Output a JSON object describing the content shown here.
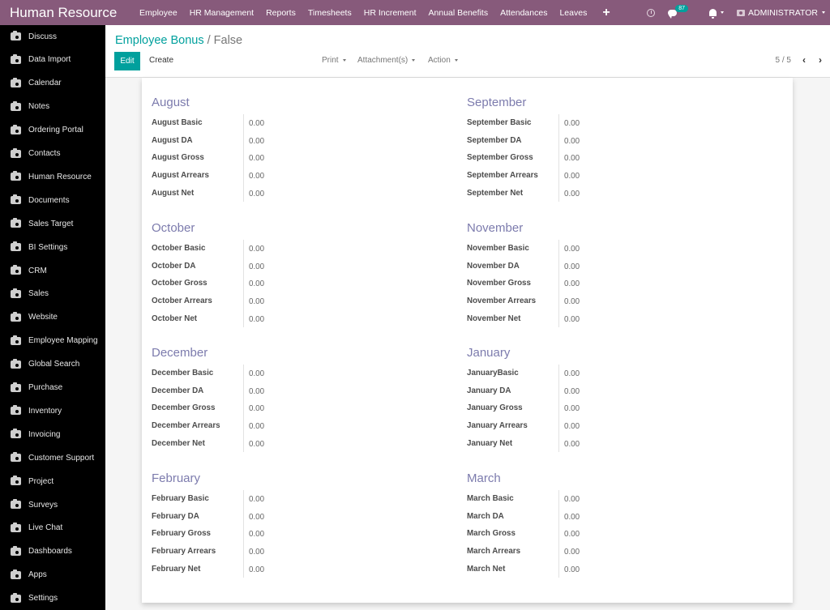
{
  "app_title": "Human Resource",
  "top_menu": [
    "Employee",
    "HR Management",
    "Reports",
    "Timesheets",
    "HR Increment",
    "Annual Benefits",
    "Attendances",
    "Leaves"
  ],
  "systray": {
    "chat_badge": "87",
    "user_name": "ADMINISTRATOR"
  },
  "sidebar": {
    "items": [
      "Discuss",
      "Data Import",
      "Calendar",
      "Notes",
      "Ordering Portal",
      "Contacts",
      "Human Resource",
      "Documents",
      "Sales Target",
      "BI Settings",
      "CRM",
      "Sales",
      "Website",
      "Employee Mapping",
      "Global Search",
      "Purchase",
      "Inventory",
      "Invoicing",
      "Customer Support",
      "Project",
      "Surveys",
      "Live Chat",
      "Dashboards",
      "Apps",
      "Settings"
    ]
  },
  "control_panel": {
    "breadcrumb_parent": "Employee Bonus",
    "breadcrumb_separator": "/",
    "breadcrumb_current": "False",
    "edit_label": "Edit",
    "create_label": "Create",
    "print_label": "Print",
    "attachments_label": "Attachment(s)",
    "action_label": "Action",
    "pager": "5 / 5"
  },
  "groups": [
    {
      "title": "August",
      "fields": [
        {
          "label": "August Basic",
          "value": "0.00"
        },
        {
          "label": "August DA",
          "value": "0.00"
        },
        {
          "label": "August Gross",
          "value": "0.00"
        },
        {
          "label": "August Arrears",
          "value": "0.00"
        },
        {
          "label": "August Net",
          "value": "0.00"
        }
      ]
    },
    {
      "title": "September",
      "fields": [
        {
          "label": "September Basic",
          "value": "0.00"
        },
        {
          "label": "September DA",
          "value": "0.00"
        },
        {
          "label": "September Gross",
          "value": "0.00"
        },
        {
          "label": "September Arrears",
          "value": "0.00"
        },
        {
          "label": "September Net",
          "value": "0.00"
        }
      ]
    },
    {
      "title": "October",
      "fields": [
        {
          "label": "October Basic",
          "value": "0.00"
        },
        {
          "label": "October DA",
          "value": "0.00"
        },
        {
          "label": "October Gross",
          "value": "0.00"
        },
        {
          "label": "October Arrears",
          "value": "0.00"
        },
        {
          "label": "October Net",
          "value": "0.00"
        }
      ]
    },
    {
      "title": "November",
      "fields": [
        {
          "label": "November Basic",
          "value": "0.00"
        },
        {
          "label": "November DA",
          "value": "0.00"
        },
        {
          "label": "November Gross",
          "value": "0.00"
        },
        {
          "label": "November Arrears",
          "value": "0.00"
        },
        {
          "label": "November Net",
          "value": "0.00"
        }
      ]
    },
    {
      "title": "December",
      "fields": [
        {
          "label": "December Basic",
          "value": "0.00"
        },
        {
          "label": "December DA",
          "value": "0.00"
        },
        {
          "label": "December Gross",
          "value": "0.00"
        },
        {
          "label": "December Arrears",
          "value": "0.00"
        },
        {
          "label": "December Net",
          "value": "0.00"
        }
      ]
    },
    {
      "title": "January",
      "fields": [
        {
          "label": "JanuaryBasic",
          "value": "0.00"
        },
        {
          "label": "January DA",
          "value": "0.00"
        },
        {
          "label": "January Gross",
          "value": "0.00"
        },
        {
          "label": "January Arrears",
          "value": "0.00"
        },
        {
          "label": "January Net",
          "value": "0.00"
        }
      ]
    },
    {
      "title": "February",
      "fields": [
        {
          "label": "February Basic",
          "value": "0.00"
        },
        {
          "label": "February DA",
          "value": "0.00"
        },
        {
          "label": "February Gross",
          "value": "0.00"
        },
        {
          "label": "February Arrears",
          "value": "0.00"
        },
        {
          "label": "February Net",
          "value": "0.00"
        }
      ]
    },
    {
      "title": "March",
      "fields": [
        {
          "label": "March Basic",
          "value": "0.00"
        },
        {
          "label": "March DA",
          "value": "0.00"
        },
        {
          "label": "March Gross",
          "value": "0.00"
        },
        {
          "label": "March Arrears",
          "value": "0.00"
        },
        {
          "label": "March Net",
          "value": "0.00"
        }
      ]
    }
  ]
}
